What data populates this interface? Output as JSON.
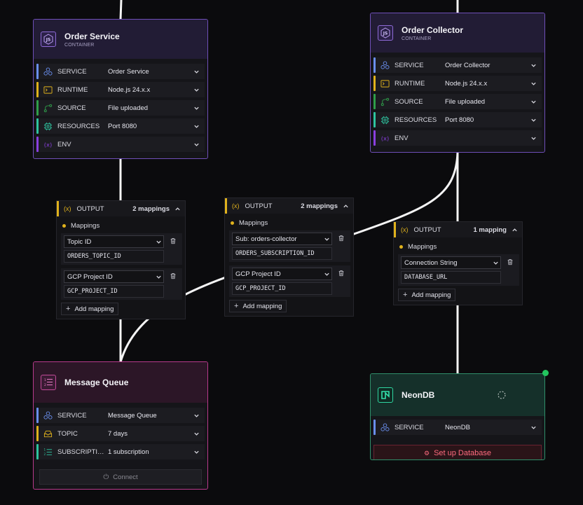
{
  "colors": {
    "bg": "#0b0b0d",
    "purple": "#6f4fb8",
    "pink": "#b83a8c",
    "green": "#2f8f6a",
    "yellow": "#e0b21c",
    "status_dot": "#22c55e"
  },
  "order_service": {
    "title": "Order Service",
    "subtitle": "CONTAINER",
    "icon": "nodejs-icon",
    "rows": [
      {
        "label": "SERVICE",
        "value": "Order Service",
        "icon": "service-hex-icon",
        "color": "#6a8ff0"
      },
      {
        "label": "RUNTIME",
        "value": "Node.js 24.x.x",
        "icon": "terminal-icon",
        "color": "#e0b21c"
      },
      {
        "label": "SOURCE",
        "value": "File uploaded",
        "icon": "git-branch-icon",
        "color": "#2f9e4a"
      },
      {
        "label": "RESOURCES",
        "value": "Port 8080",
        "icon": "cpu-chip-icon",
        "color": "#2ec4a0"
      },
      {
        "label": "ENV",
        "value": "",
        "icon": "variable-icon",
        "color": "#8a3fe0"
      }
    ]
  },
  "order_collector": {
    "title": "Order Collector",
    "subtitle": "CONTAINER",
    "icon": "nodejs-icon",
    "rows": [
      {
        "label": "SERVICE",
        "value": "Order Collector",
        "icon": "service-hex-icon",
        "color": "#6a8ff0"
      },
      {
        "label": "RUNTIME",
        "value": "Node.js 24.x.x",
        "icon": "terminal-icon",
        "color": "#e0b21c"
      },
      {
        "label": "SOURCE",
        "value": "File uploaded",
        "icon": "git-branch-icon",
        "color": "#2f9e4a"
      },
      {
        "label": "RESOURCES",
        "value": "Port 8080",
        "icon": "cpu-chip-icon",
        "color": "#2ec4a0"
      },
      {
        "label": "ENV",
        "value": "",
        "icon": "variable-icon",
        "color": "#8a3fe0"
      }
    ]
  },
  "message_queue": {
    "title": "Message Queue",
    "icon": "list-numbered-icon",
    "rows": [
      {
        "label": "SERVICE",
        "value": "Message Queue",
        "icon": "service-hex-icon",
        "color": "#6a8ff0"
      },
      {
        "label": "TOPIC",
        "value": "7 days",
        "icon": "inbox-icon",
        "color": "#e0b21c"
      },
      {
        "label": "SUBSCRIPTIO...",
        "value": "1 subscription",
        "icon": "list-numbered-icon",
        "color": "#2ec4a0"
      }
    ],
    "connect_label": "Connect"
  },
  "neondb": {
    "title": "NeonDB",
    "icon": "neon-logo-icon",
    "rows": [
      {
        "label": "SERVICE",
        "value": "NeonDB",
        "icon": "service-hex-icon",
        "color": "#6a8ff0"
      }
    ],
    "setup_label": "Set up Database"
  },
  "outputs": {
    "left": {
      "label": "OUTPUT",
      "count": "2 mappings",
      "mappings_title": "Mappings",
      "mappings": [
        {
          "select": "Topic ID",
          "value": "ORDERS_TOPIC_ID"
        },
        {
          "select": "GCP Project ID",
          "value": "GCP_PROJECT_ID"
        }
      ],
      "add_label": "Add mapping"
    },
    "middle": {
      "label": "OUTPUT",
      "count": "2 mappings",
      "mappings_title": "Mappings",
      "mappings": [
        {
          "select": "Sub: orders-collector",
          "value": "ORDERS_SUBSCRIPTION_ID"
        },
        {
          "select": "GCP Project ID",
          "value": "GCP_PROJECT_ID"
        }
      ],
      "add_label": "Add mapping"
    },
    "right": {
      "label": "OUTPUT",
      "count": "1 mapping",
      "mappings_title": "Mappings",
      "mappings": [
        {
          "select": "Connection String",
          "value": "DATABASE_URL"
        }
      ],
      "add_label": "Add mapping"
    }
  }
}
